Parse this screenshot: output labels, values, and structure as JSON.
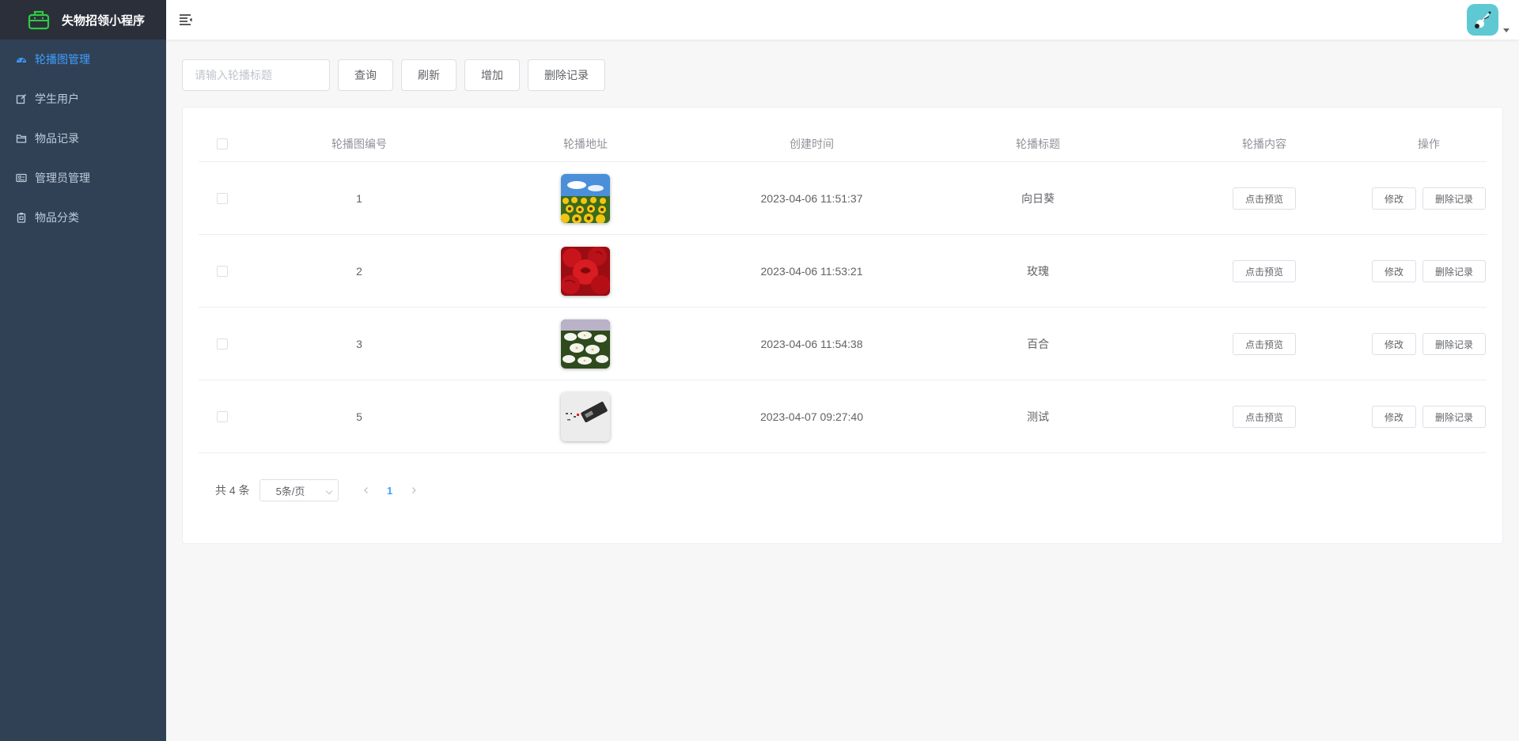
{
  "app": {
    "title": "失物招领小程序"
  },
  "sidebar": {
    "items": [
      {
        "label": "轮播图管理",
        "icon": "dashboard-icon",
        "active": true
      },
      {
        "label": "学生用户",
        "icon": "edit-icon",
        "active": false
      },
      {
        "label": "物品记录",
        "icon": "folder-icon",
        "active": false
      },
      {
        "label": "管理员管理",
        "icon": "id-card-icon",
        "active": false
      },
      {
        "label": "物品分类",
        "icon": "clipboard-icon",
        "active": false
      }
    ]
  },
  "toolbar": {
    "search_placeholder": "请输入轮播标题",
    "search_value": "",
    "query_label": "查询",
    "refresh_label": "刷新",
    "add_label": "增加",
    "delete_label": "删除记录"
  },
  "table": {
    "headers": [
      "轮播图编号",
      "轮播地址",
      "创建时间",
      "轮播标题",
      "轮播内容",
      "操作"
    ],
    "rows": [
      {
        "id": "1",
        "image": "sunflower",
        "created": "2023-04-06 11:51:37",
        "title": "向日葵",
        "preview": "点击预览",
        "edit": "修改",
        "delete": "删除记录"
      },
      {
        "id": "2",
        "image": "rose",
        "created": "2023-04-06 11:53:21",
        "title": "玫瑰",
        "preview": "点击预览",
        "edit": "修改",
        "delete": "删除记录"
      },
      {
        "id": "3",
        "image": "lily",
        "created": "2023-04-06 11:54:38",
        "title": "百合",
        "preview": "点击预览",
        "edit": "修改",
        "delete": "删除记录"
      },
      {
        "id": "5",
        "image": "device",
        "created": "2023-04-07 09:27:40",
        "title": "测试",
        "preview": "点击预览",
        "edit": "修改",
        "delete": "删除记录"
      }
    ]
  },
  "pagination": {
    "total_label": "共 4 条",
    "page_size": "5条/页",
    "current_page": "1"
  },
  "colors": {
    "sidebar_bg": "#304156",
    "brand_bg": "#2b2f3a",
    "accent": "#409eff",
    "brand_icon": "#2ecc40",
    "avatar_bg": "#5fc9d3"
  }
}
